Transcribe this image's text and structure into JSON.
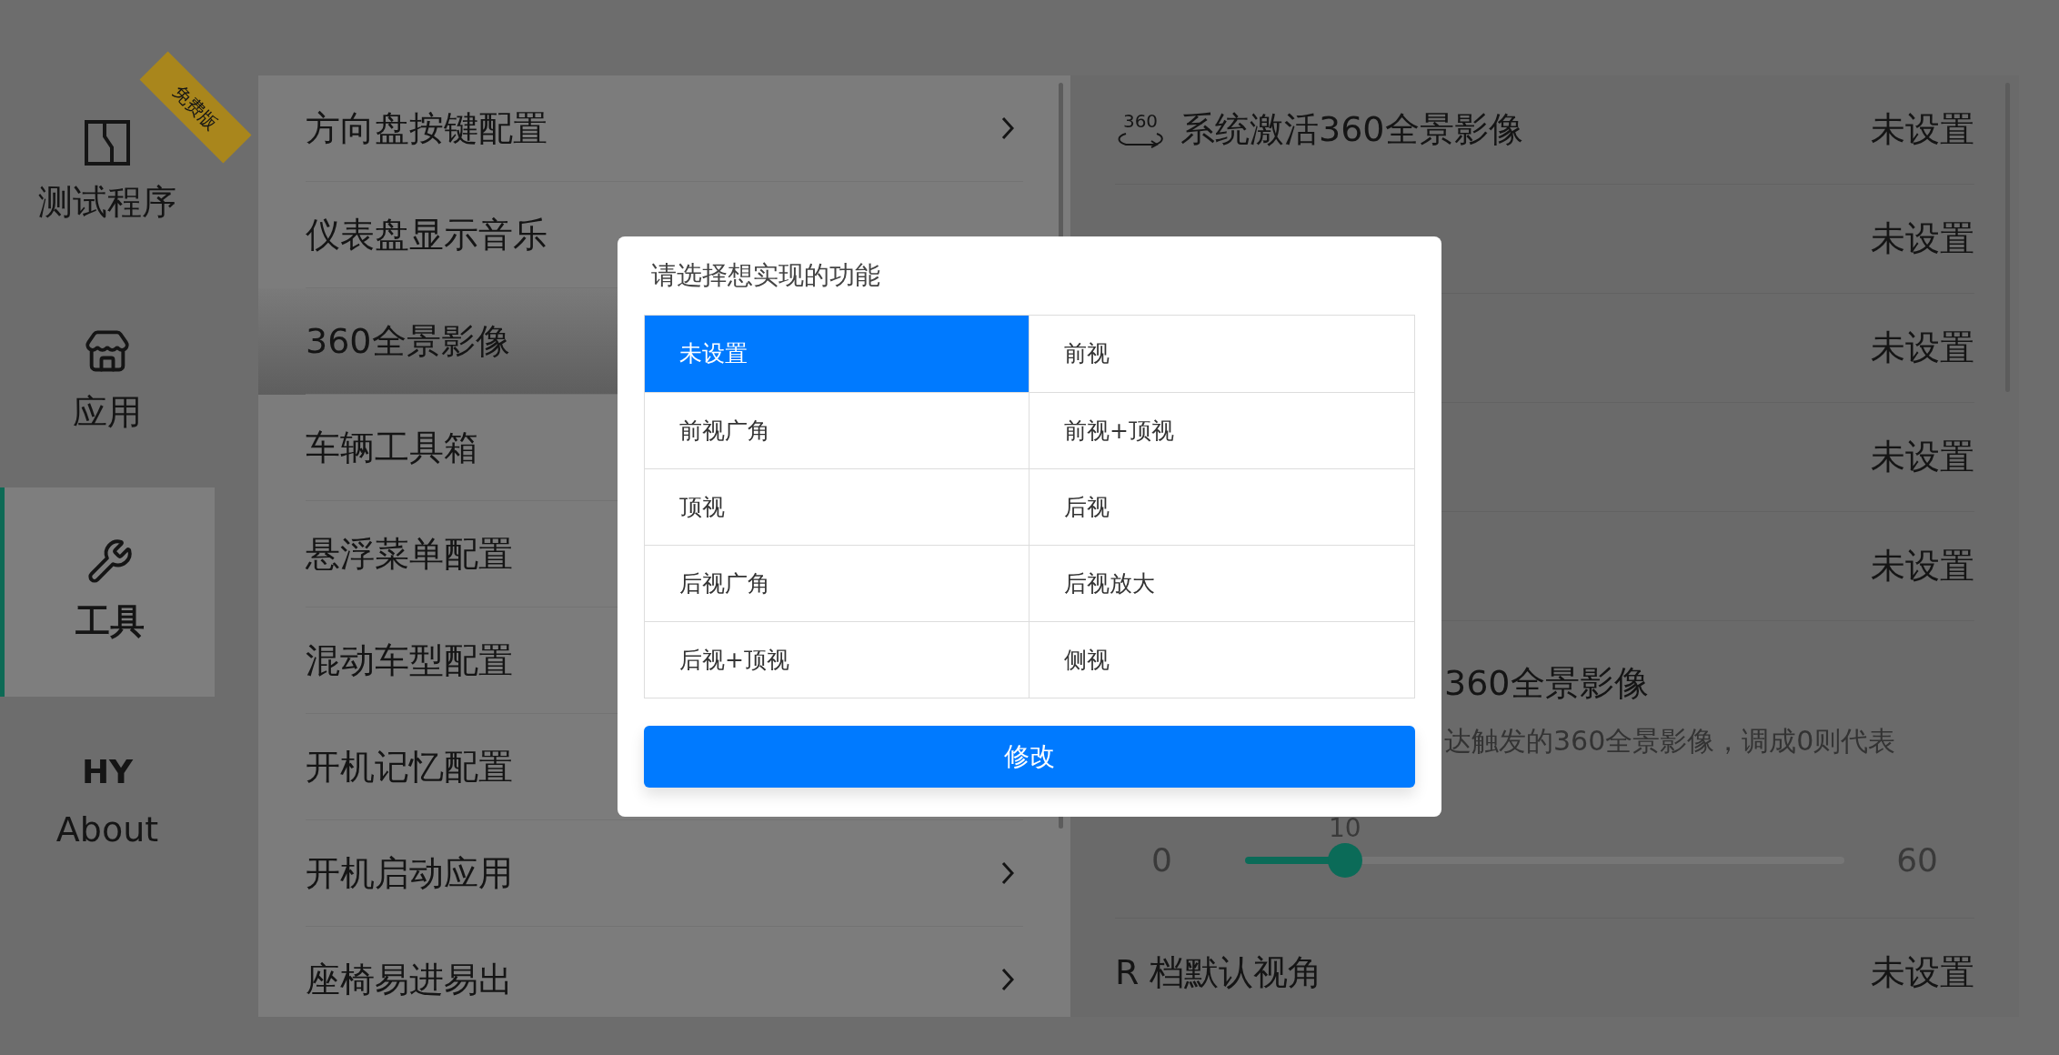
{
  "sidebar": {
    "badge": "免费版",
    "items": [
      {
        "kind": "test",
        "label": "测试程序",
        "selected": false
      },
      {
        "kind": "store",
        "label": "应用",
        "selected": false
      },
      {
        "kind": "tools",
        "label": "工具",
        "selected": true
      },
      {
        "kind": "logo",
        "logo": "HY",
        "label": "About",
        "selected": false
      }
    ]
  },
  "menu": {
    "items": [
      {
        "kind": "link",
        "label": "方向盘按键配置",
        "selected": false
      },
      {
        "kind": "plain",
        "label": "仪表盘显示音乐",
        "selected": false
      },
      {
        "kind": "plain",
        "label": "360全景影像",
        "selected": true
      },
      {
        "kind": "plain",
        "label": "车辆工具箱",
        "selected": false
      },
      {
        "kind": "plain",
        "label": "悬浮菜单配置",
        "selected": false
      },
      {
        "kind": "plain",
        "label": "混动车型配置",
        "selected": false
      },
      {
        "kind": "plain",
        "label": "开机记忆配置",
        "selected": false
      },
      {
        "kind": "link",
        "label": "开机启动应用",
        "selected": false
      },
      {
        "kind": "link",
        "label": "座椅易进易出",
        "selected": false
      }
    ]
  },
  "settings": {
    "rows": [
      {
        "kind": "option",
        "icon_text": "360",
        "label": "系统激活360全景影像",
        "value": "未设置"
      },
      {
        "kind": "option",
        "value": "未设置"
      },
      {
        "kind": "option",
        "value": "未设置"
      },
      {
        "kind": "option",
        "value": "未设置"
      },
      {
        "kind": "option",
        "value": "未设置"
      },
      {
        "kind": "slider",
        "title": "360全景影像",
        "description": "达触发的360全景影像，调成0则代表",
        "min": "0",
        "max": "60",
        "reading": "10",
        "level": 0.1667
      },
      {
        "kind": "option",
        "label": "R 档默认视角",
        "value": "未设置"
      }
    ]
  },
  "dialog": {
    "title": "请选择想实现的功能",
    "options": [
      {
        "label": "未设置",
        "selected": true
      },
      {
        "label": "前视",
        "selected": false
      },
      {
        "label": "前视广角",
        "selected": false
      },
      {
        "label": "前视+顶视",
        "selected": false
      },
      {
        "label": "顶视",
        "selected": false
      },
      {
        "label": "后视",
        "selected": false
      },
      {
        "label": "后视广角",
        "selected": false
      },
      {
        "label": "后视放大",
        "selected": false
      },
      {
        "label": "后视+顶视",
        "selected": false
      },
      {
        "label": "侧视",
        "selected": false
      }
    ],
    "button": "修改"
  }
}
